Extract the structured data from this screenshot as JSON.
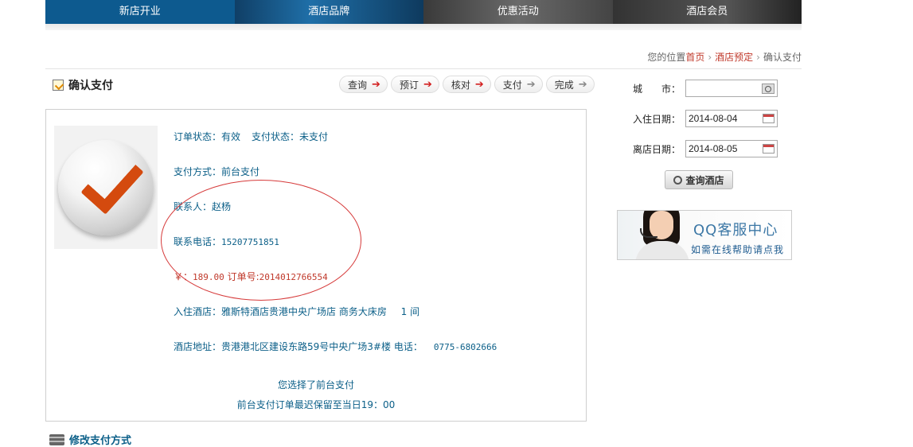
{
  "nav": [
    "新店开业",
    "酒店品牌",
    "优惠活动",
    "酒店会员"
  ],
  "breadcrumb": {
    "prefix": "您的位置",
    "home": "首页",
    "booking": "酒店预定",
    "current": "确认支付"
  },
  "page_title": "确认支付",
  "steps": [
    {
      "label": "查询",
      "state": "done"
    },
    {
      "label": "预订",
      "state": "done"
    },
    {
      "label": "核对",
      "state": "done"
    },
    {
      "label": "支付",
      "state": "pending"
    },
    {
      "label": "完成",
      "state": "pending"
    }
  ],
  "order": {
    "order_status": "订单状态：有效",
    "pay_status": "支付状态：未支付",
    "pay_method": "支付方式：前台支付",
    "contact_label": "联系人：",
    "contact": "赵杨",
    "phone_label": "联系电话：",
    "phone": "15207751851",
    "price_prefix": "￥：",
    "price": "189.00",
    "order_no_label": "订单号:",
    "order_no": "2014012766554",
    "hotel_label": "入住酒店：",
    "hotel": "雅斯特酒店贵港中央广场店 商务大床房",
    "rooms": "1 间",
    "address_label": "酒店地址：",
    "address": "贵港港北区建设东路59号中央广场3#楼",
    "hotel_phone_label": "电话：",
    "hotel_phone": "0775-6802666",
    "note1": "您选择了前台支付",
    "note2": "前台支付订单最迟保留至当日19：00"
  },
  "modify_link": "修改支付方式",
  "side": {
    "city_label": "城　　市：",
    "city_value": "",
    "checkin_label": "入住日期：",
    "checkin_value": "2014-08-04",
    "checkout_label": "离店日期：",
    "checkout_value": "2014-08-05",
    "query_button": "查询酒店"
  },
  "qq": {
    "title": "QQ客服中心",
    "sub": "如需在线帮助请点我"
  },
  "colors": {
    "accent_red": "#c0392b",
    "link_blue": "#0b5f88",
    "nav_blue": "#0d5a8f"
  }
}
